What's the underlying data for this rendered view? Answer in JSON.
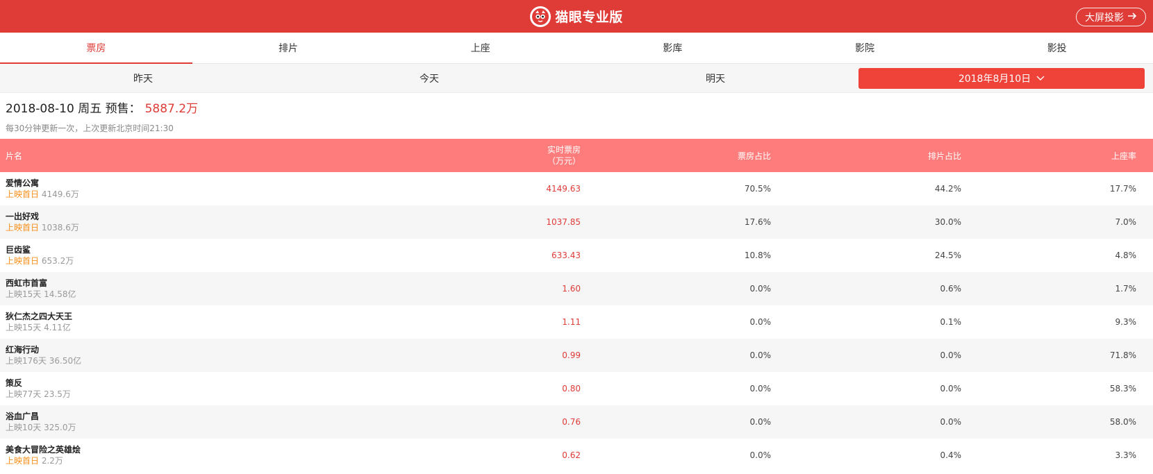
{
  "header": {
    "brand": "猫眼专业版",
    "projection_label": "大屏投影"
  },
  "nav": {
    "tabs": [
      {
        "label": "票房",
        "active": true
      },
      {
        "label": "排片",
        "active": false
      },
      {
        "label": "上座",
        "active": false
      },
      {
        "label": "影库",
        "active": false
      },
      {
        "label": "影院",
        "active": false
      },
      {
        "label": "影投",
        "active": false
      }
    ]
  },
  "datebar": {
    "yesterday": "昨天",
    "today": "今天",
    "tomorrow": "明天",
    "picker": "2018年8月10日"
  },
  "summary": {
    "date_label": "2018-08-10 周五 预售：",
    "presale": "5887.2万",
    "note": "每30分钟更新一次，上次更新北京时间21:30"
  },
  "table": {
    "columns": {
      "name": "片名",
      "box_line1": "实时票房",
      "box_line2": "（万元）",
      "box_ratio": "票房占比",
      "show_ratio": "排片占比",
      "seat_rate": "上座率"
    },
    "rows": [
      {
        "title": "爱情公寓",
        "release": "上映首日",
        "release_new": true,
        "total": "4149.6万",
        "box": "4149.63",
        "box_ratio": "70.5%",
        "show_ratio": "44.2%",
        "seat_rate": "17.7%"
      },
      {
        "title": "一出好戏",
        "release": "上映首日",
        "release_new": true,
        "total": "1038.6万",
        "box": "1037.85",
        "box_ratio": "17.6%",
        "show_ratio": "30.0%",
        "seat_rate": "7.0%"
      },
      {
        "title": "巨齿鲨",
        "release": "上映首日",
        "release_new": true,
        "total": "653.2万",
        "box": "633.43",
        "box_ratio": "10.8%",
        "show_ratio": "24.5%",
        "seat_rate": "4.8%"
      },
      {
        "title": "西虹市首富",
        "release": "上映15天",
        "release_new": false,
        "total": "14.58亿",
        "box": "1.60",
        "box_ratio": "0.0%",
        "show_ratio": "0.6%",
        "seat_rate": "1.7%"
      },
      {
        "title": "狄仁杰之四大天王",
        "release": "上映15天",
        "release_new": false,
        "total": "4.11亿",
        "box": "1.11",
        "box_ratio": "0.0%",
        "show_ratio": "0.1%",
        "seat_rate": "9.3%"
      },
      {
        "title": "红海行动",
        "release": "上映176天",
        "release_new": false,
        "total": "36.50亿",
        "box": "0.99",
        "box_ratio": "0.0%",
        "show_ratio": "0.0%",
        "seat_rate": "71.8%"
      },
      {
        "title": "策反",
        "release": "上映77天",
        "release_new": false,
        "total": "23.5万",
        "box": "0.80",
        "box_ratio": "0.0%",
        "show_ratio": "0.0%",
        "seat_rate": "58.3%"
      },
      {
        "title": "浴血广昌",
        "release": "上映10天",
        "release_new": false,
        "total": "325.0万",
        "box": "0.76",
        "box_ratio": "0.0%",
        "show_ratio": "0.0%",
        "seat_rate": "58.0%"
      },
      {
        "title": "美食大冒险之英雄烩",
        "release": "上映首日",
        "release_new": true,
        "total": "2.2万",
        "box": "0.62",
        "box_ratio": "0.0%",
        "show_ratio": "0.4%",
        "seat_rate": "3.3%"
      }
    ]
  }
}
